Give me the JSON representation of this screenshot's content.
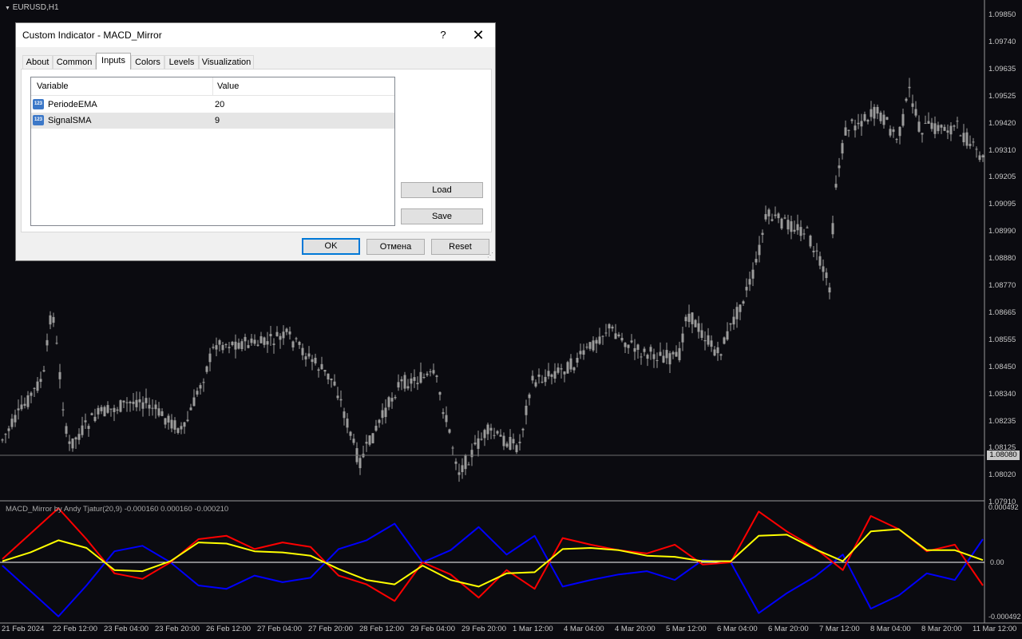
{
  "chart": {
    "symbol": "EURUSD,H1",
    "price_axis": [
      "1.09850",
      "1.09740",
      "1.09635",
      "1.09525",
      "1.09420",
      "1.09310",
      "1.09205",
      "1.09095",
      "1.08990",
      "1.08880",
      "1.08770",
      "1.08665",
      "1.08555",
      "1.08450",
      "1.08340",
      "1.08235",
      "1.08125",
      "1.08020",
      "1.07910"
    ],
    "current_price": "1.08080",
    "time_axis": [
      "21 Feb 2024",
      "22 Feb 12:00",
      "23 Feb 04:00",
      "23 Feb 20:00",
      "26 Feb 12:00",
      "27 Feb 04:00",
      "27 Feb 20:00",
      "28 Feb 12:00",
      "29 Feb 04:00",
      "29 Feb 20:00",
      "1 Mar 12:00",
      "4 Mar 04:00",
      "4 Mar 20:00",
      "5 Mar 12:00",
      "6 Mar 04:00",
      "6 Mar 20:00",
      "7 Mar 12:00",
      "8 Mar 04:00",
      "8 Mar 20:00",
      "11 Mar 12:00"
    ],
    "colors": {
      "background": "#0b0b10",
      "candles": "#9c9c9c",
      "macd": "#ff0000",
      "mirror": "#0000ff",
      "signal": "#ffff00",
      "zero_line": "#ffffff"
    }
  },
  "indicator": {
    "label": "MACD_Mirror by Andy Tjatur(20,9) -0.000160 0.000160 -0.000210",
    "axis": [
      "0.000492",
      "0.00",
      "-0.000492"
    ]
  },
  "chart_data": {
    "type": "line",
    "title": "MACD_Mirror by Andy Tjatur(20,9)",
    "series": [
      {
        "name": "MACD",
        "values": [
          3e-05,
          0.00026,
          0.00049,
          0.00021,
          -0.0001,
          -0.00015,
          0.0,
          0.00021,
          0.00024,
          0.00012,
          0.00018,
          0.00014,
          -0.00012,
          -0.0002,
          -0.00035,
          0.0,
          -0.00011,
          -0.00032,
          -7e-05,
          -0.00024,
          0.00022,
          0.00016,
          0.00011,
          8e-05,
          0.00016,
          -2e-05,
          0.0,
          0.00046,
          0.00028,
          0.00013,
          -7e-05,
          0.00042,
          0.0003,
          0.0001,
          0.00016,
          -0.00021
        ]
      },
      {
        "name": "Signal",
        "values": [
          1e-05,
          9e-05,
          0.0002,
          0.00013,
          -7e-05,
          -8e-05,
          1e-05,
          0.00018,
          0.00017,
          0.0001,
          9e-05,
          6e-05,
          -6e-05,
          -0.00016,
          -0.0002,
          -3e-05,
          -0.00016,
          -0.00022,
          -0.0001,
          -9e-05,
          0.00012,
          0.00013,
          0.00011,
          6e-05,
          5e-05,
          1e-05,
          1e-05,
          0.00024,
          0.00025,
          0.00012,
          1e-05,
          0.00028,
          0.0003,
          0.00011,
          0.00011,
          2e-05
        ]
      }
    ],
    "ylim": [
      -0.000492,
      0.000492
    ]
  },
  "dialog": {
    "title": "Custom Indicator - MACD_Mirror",
    "help": "?",
    "close": "✕",
    "tabs": [
      "About",
      "Common",
      "Inputs",
      "Colors",
      "Levels",
      "Visualization"
    ],
    "active_tab": "Inputs",
    "columns": {
      "variable": "Variable",
      "value": "Value"
    },
    "rows": [
      {
        "icon": "123",
        "name": "PeriodeEMA",
        "value": "20"
      },
      {
        "icon": "123",
        "name": "SignalSMA",
        "value": "9"
      }
    ],
    "buttons": {
      "load": "Load",
      "save": "Save",
      "ok": "OK",
      "cancel": "Отмена",
      "reset": "Reset"
    }
  }
}
